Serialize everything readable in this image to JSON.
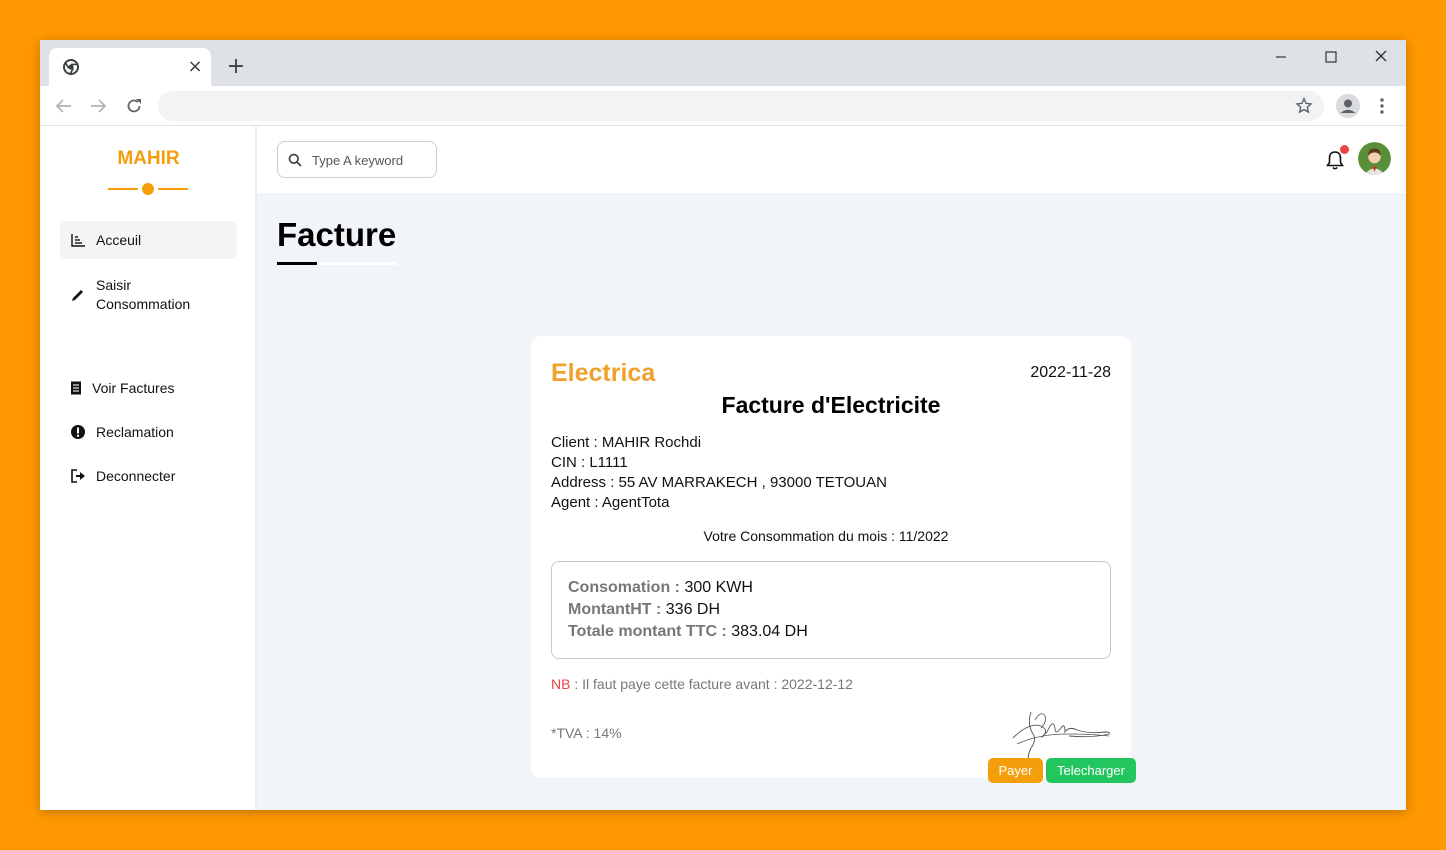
{
  "browser": {
    "tab_close": "×",
    "new_tab": "+"
  },
  "sidebar": {
    "brand": "MAHIR",
    "items": [
      {
        "label": "Acceuil",
        "icon": "chart-icon"
      },
      {
        "label": "Saisir Consommation",
        "icon": "pencil-icon"
      },
      {
        "label": "Voir Factures",
        "icon": "receipt-icon"
      },
      {
        "label": "Reclamation",
        "icon": "exclamation-icon"
      },
      {
        "label": "Deconnecter",
        "icon": "sign-out-icon"
      }
    ]
  },
  "header": {
    "search_placeholder": "Type A keyword"
  },
  "page": {
    "title": "Facture"
  },
  "invoice": {
    "company": "Electrica",
    "date": "2022-11-28",
    "title": "Facture d'Electricite",
    "client": "Client : MAHIR Rochdi",
    "cin": "CIN : L1111",
    "address": "Address : 55 AV MARRAKECH , 93000 TETOUAN",
    "agent": "Agent : AgentTota",
    "period": "Votre Consommation du mois : 11/2022",
    "consumption_label": "Consomation :",
    "consumption_value": "300 KWH",
    "montant_ht_label": "MontantHT :",
    "montant_ht_value": "336 DH",
    "total_ttc_label": "Totale montant TTC :",
    "total_ttc_value": "383.04 DH",
    "nb_label": "NB",
    "nb_text": ": Il faut paye cette facture avant : 2022-12-12",
    "tva": "*TVA : 14%"
  },
  "actions": {
    "pay": "Payer",
    "download": "Telecharger"
  },
  "colors": {
    "background": "#ff9800",
    "accent": "#f59e0b",
    "company": "#f0a12c",
    "download": "#22c55e",
    "alert": "#ef4444"
  }
}
